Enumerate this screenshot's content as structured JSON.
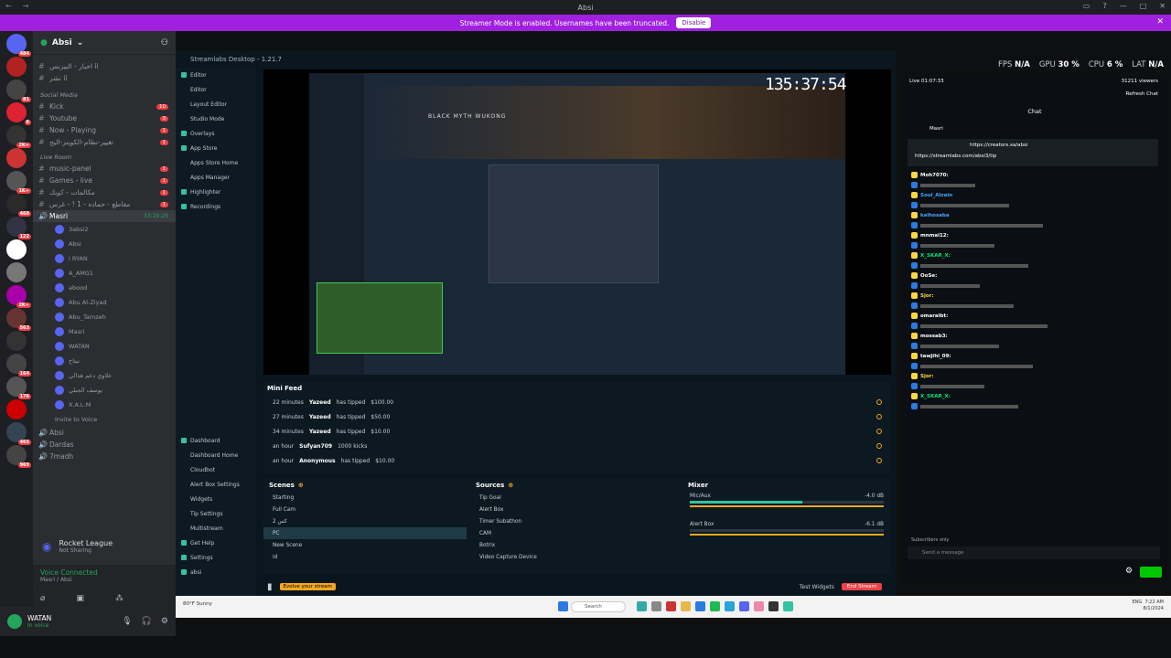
{
  "window": {
    "title": "Absi"
  },
  "banner": {
    "text": "Streamer Mode is enabled. Usernames have been truncated.",
    "button": "Disable"
  },
  "sidebar": {
    "server_name": "Absi",
    "channels_top": [
      {
        "name": "اخبار - البيزنس ii",
        "hash": "#"
      },
      {
        "name": "نشر ii",
        "hash": "#"
      }
    ],
    "cat_social": "Social Media",
    "social": [
      {
        "name": "Kick",
        "count": "10"
      },
      {
        "name": "Youtube",
        "count": "3"
      },
      {
        "name": "Now - Playing",
        "count": "1"
      },
      {
        "name": "تغيير-نظام-الكوينز-اليح",
        "count": "1"
      }
    ],
    "cat_live": "Live Room",
    "live": [
      {
        "name": "music-panel",
        "count": "1"
      },
      {
        "name": "Games - live",
        "count": "1"
      },
      {
        "name": "مكالمات - كوبك",
        "count": "1"
      },
      {
        "name": "مقاطع - حماده - 1 ! - غرس",
        "count": "1"
      }
    ],
    "voice_channel": "Masri",
    "voice_time": "33:29:29",
    "voice_users": [
      "3absi2",
      "Absi",
      "i RYAN",
      "A_AMG1",
      "abood",
      "Abu Al-Ziyad",
      "Abu_Tamzeh",
      "Masri",
      "WATAN",
      "تيتاح",
      "علاوي دعم هذالي",
      "يوسف الجبلي",
      "X.A.L.M"
    ],
    "invite": "Invite to Voice",
    "more_voice": [
      "Absi",
      "Dardas",
      "7madh"
    ],
    "activity": {
      "title": "Rocket League",
      "sub": "Not Sharing"
    },
    "voice_connected": {
      "title": "Voice Connected",
      "sub": "Masri / Absi"
    },
    "user": {
      "name": "WATAN",
      "status": "In voice"
    }
  },
  "slobs": {
    "header": "Streamlabs Desktop - 1.21.7",
    "nav": [
      {
        "label": "Editor",
        "sub": false
      },
      {
        "label": "Editor",
        "sub": true
      },
      {
        "label": "Layout Editor",
        "sub": true
      },
      {
        "label": "Studio Mode",
        "sub": true
      },
      {
        "label": "Overlays",
        "sub": false
      },
      {
        "label": "App Store",
        "sub": false
      },
      {
        "label": "Apps Store Home",
        "sub": true
      },
      {
        "label": "Apps Manager",
        "sub": true
      },
      {
        "label": "Highlighter",
        "sub": false
      },
      {
        "label": "Recordings",
        "sub": false
      }
    ],
    "nav_bottom": [
      {
        "label": "Dashboard",
        "sub": false
      },
      {
        "label": "Dashboard Home",
        "sub": true
      },
      {
        "label": "Cloudbot",
        "sub": true
      },
      {
        "label": "Alert Box Settings",
        "sub": true
      },
      {
        "label": "Widgets",
        "sub": true
      },
      {
        "label": "Tip Settings",
        "sub": true
      },
      {
        "label": "Multistream",
        "sub": true
      },
      {
        "label": "Get Help",
        "sub": false
      },
      {
        "label": "Settings",
        "sub": false
      },
      {
        "label": "absi",
        "sub": false
      }
    ],
    "timer": "135:37:54",
    "game_title": "BLACK MYTH WUKONG",
    "mini_feed_title": "Mini Feed",
    "mini_feed": [
      {
        "time": "22 minutes",
        "user": "Yazeed",
        "action": "has tipped",
        "amount": "$100.00"
      },
      {
        "time": "27 minutes",
        "user": "Yazeed",
        "action": "has tipped",
        "amount": "$50.00"
      },
      {
        "time": "34 minutes",
        "user": "Yazeed",
        "action": "has tipped",
        "amount": "$10.00"
      },
      {
        "time": "an hour",
        "user": "Sufyan709",
        "action": "1000 kicks",
        "amount": ""
      },
      {
        "time": "an hour",
        "user": "Anonymous",
        "action": "has tipped",
        "amount": "$10.00"
      }
    ],
    "scenes_title": "Scenes",
    "scenes": [
      "Starting",
      "Full Cam",
      "كس 2",
      "PC",
      "New Scene",
      "id"
    ],
    "sources_title": "Sources",
    "sources": [
      "Tip Goal",
      "Alert Box",
      "Timer Subathon",
      "CAM",
      "Botrix",
      "Video Capture Device"
    ],
    "mixer_title": "Mixer",
    "mixer": [
      {
        "name": "Mic/Aux",
        "db": "-4.0 dB",
        "level": 0.58
      },
      {
        "name": "Alert Box",
        "db": "-6.1 dB",
        "level": 0.0
      }
    ],
    "footer": {
      "tip": "Evolve your stream",
      "test_widgets": "Test Widgets",
      "go_live": "End Stream"
    }
  },
  "stats": {
    "fps_label": "FPS",
    "fps": "N/A",
    "gpu_label": "GPU",
    "gpu": "30 %",
    "cpu_label": "CPU",
    "cpu": "6 %",
    "lat_label": "LAT",
    "lat": "N/A"
  },
  "chat": {
    "live_time": "Live 01:07:33",
    "viewers": "31211 viewers",
    "refresh": "Refresh Chat",
    "title": "Chat",
    "pinned_user": "Masri",
    "pinned_link": "https://creators.sa/absi",
    "pinned_link2": "https://streamlabs.com/absi3/tip",
    "messages": [
      {
        "user": "Moh7070:",
        "color": "#ffffff"
      },
      {
        "user": "Soul_Alzain",
        "color": "#4aa3ff"
      },
      {
        "user": "kalhosaba",
        "color": "#4aa3ff"
      },
      {
        "user": "mnmal12:",
        "color": "#ffffff"
      },
      {
        "user": "X_SKAR_X:",
        "color": "#00e676"
      },
      {
        "user": "OoSe:",
        "color": "#ffffff"
      },
      {
        "user": "Sjor:",
        "color": "#ffd740"
      },
      {
        "user": "omaralbt:",
        "color": "#ffffff"
      },
      {
        "user": "mossab3:",
        "color": "#ffffff"
      },
      {
        "user": "tawjihi_09:",
        "color": "#ffffff"
      },
      {
        "user": "Sjor:",
        "color": "#ffd740"
      },
      {
        "user": "X_SKAR_X:",
        "color": "#00e676"
      }
    ],
    "subs_only": "Subscribers only",
    "send_placeholder": "Send a message"
  },
  "taskbar": {
    "weather": "80°F Sunny",
    "search": "Search",
    "lang": "ENG",
    "time": "7:22 AM",
    "date": "8/1/2024"
  }
}
